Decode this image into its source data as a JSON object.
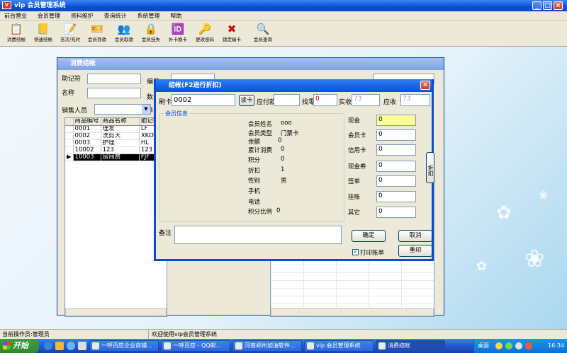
{
  "window": {
    "title": "vip 会员管理系统",
    "icon": "app-icon"
  },
  "menu": [
    "前台营业",
    "会员管理",
    "资料维护",
    "查询统计",
    "系统管理",
    "帮助"
  ],
  "toolbar": [
    {
      "label": "消费结帐",
      "icon": "📋"
    },
    {
      "label": "快速结帐",
      "icon": "📒"
    },
    {
      "label": "充次/充时",
      "icon": "📝"
    },
    {
      "label": "会员存款",
      "icon": "🎫"
    },
    {
      "label": "会员取款",
      "icon": "👥"
    },
    {
      "label": "会员挂失",
      "icon": "🔒"
    },
    {
      "label": "补卡换卡",
      "icon": "🆔"
    },
    {
      "label": "更改密码",
      "icon": "🔑"
    },
    {
      "label": "锁定输卡",
      "icon": "✖"
    },
    {
      "label": "会员查询",
      "icon": "🔍"
    }
  ],
  "child_window": {
    "title": "消费结帐",
    "labels": {
      "code": "助记符",
      "name": "名称",
      "sales": "销售人员",
      "no": "编号",
      "qty": "数",
      "price": "单"
    },
    "grid_headers": [
      "商品编号",
      "商品名称",
      "助记符"
    ],
    "grid_rows": [
      [
        "0001",
        "理发",
        "LF"
      ],
      [
        "0002",
        "洗剪大",
        "XKD"
      ],
      [
        "0003",
        "护理",
        "HL"
      ],
      [
        "10002",
        "123",
        "123"
      ],
      [
        "10003",
        "房间费",
        "FJF"
      ]
    ]
  },
  "dialog": {
    "title": "结帐(F2进行折扣)",
    "card_label": "刷卡",
    "card_value": "0002",
    "read_card_button": "读卡",
    "payable_label": "应付款",
    "change_label": "找零",
    "change_value": "0",
    "paid_label": "实收",
    "paid_value": "73",
    "received_label": "应收",
    "received_value": "73",
    "member_group_title": "会员信息",
    "member_info": [
      {
        "label": "会员姓名",
        "value": "ooo"
      },
      {
        "label": "会员类型",
        "value": "门票卡"
      },
      {
        "label": "余额",
        "value": "0"
      },
      {
        "label": "累计消费",
        "value": "0"
      },
      {
        "label": "积分",
        "value": "0"
      },
      {
        "label": "折扣",
        "value": "1"
      },
      {
        "label": "性别",
        "value": "男"
      },
      {
        "label": "手机",
        "value": ""
      },
      {
        "label": "电话",
        "value": ""
      },
      {
        "label": "积分比例",
        "value": "0"
      }
    ],
    "payments": [
      {
        "label": "现金",
        "value": "0"
      },
      {
        "label": "会员卡",
        "value": "0"
      },
      {
        "label": "信用卡",
        "value": "0"
      },
      {
        "label": "现金券",
        "value": "0"
      },
      {
        "label": "签单",
        "value": "0"
      },
      {
        "label": "挂账",
        "value": "0"
      },
      {
        "label": "其它",
        "value": "0"
      }
    ],
    "discount_button": "折扣",
    "remark_label": "备注",
    "ok_button": "确定",
    "cancel_button": "取消",
    "print_checkbox": "打印账单",
    "reprint_button": "重印"
  },
  "status": {
    "operator": "当前操作员:管理员",
    "welcome": "欢迎使用vip会员管理系统"
  },
  "taskbar": {
    "start": "开始",
    "tasks": [
      "一呼百应企业商铺...",
      "一呼百应 - QQ邮...",
      "河南郑州加油软件...",
      "vip 会员管理系统",
      "消费结帐"
    ],
    "tray_text": "桌面",
    "time": "16:34"
  },
  "colors": {
    "title_blue": "#0a50d8",
    "desktop": "#6ab4e0",
    "highlight": "#ffff99"
  }
}
